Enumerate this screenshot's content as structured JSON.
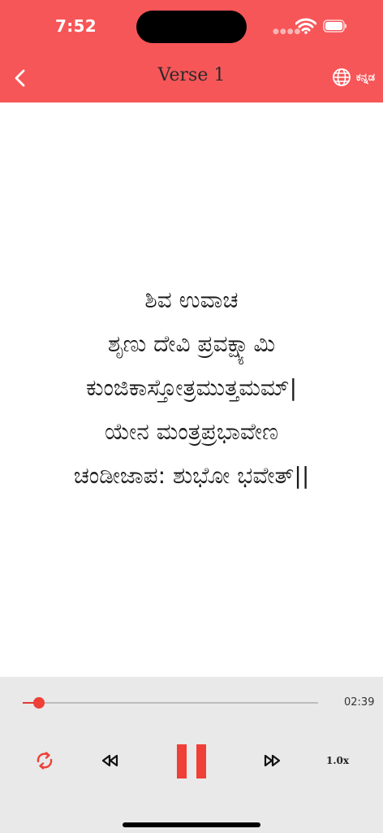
{
  "status_bar": {
    "time": "7:52"
  },
  "header": {
    "title": "Verse 1",
    "language_label": "ಕನ್ನಡ"
  },
  "verse": {
    "lines": [
      "ಶಿವ ಉವಾಚ",
      "ಶೃಣು ದೇವಿ ಪ್ರವಕ್ಷ್ಯಾಮಿ",
      "ಕುಂಜಿಕಾಸ್ತೋತ್ರಮುತ್ತಮಮ್|",
      "ಯೇನ ಮಂತ್ರಪ್ರಭಾವೇಣ",
      "ಚಂಡೀಜಾಪ: ಶುಭೋ ಭವೇತ್||"
    ]
  },
  "player": {
    "duration": "02:39",
    "progress_fraction": 0.055,
    "speed_label": "1.0x",
    "accent_color": "#ef3f37"
  },
  "icons": {
    "back": "chevron-left-icon",
    "language": "globe-icon",
    "repeat": "repeat-icon",
    "rewind": "rewind-icon",
    "pause": "pause-icon",
    "forward": "fast-forward-icon"
  },
  "colors": {
    "header": "#f75658",
    "player_bg": "#e9e9e9"
  }
}
